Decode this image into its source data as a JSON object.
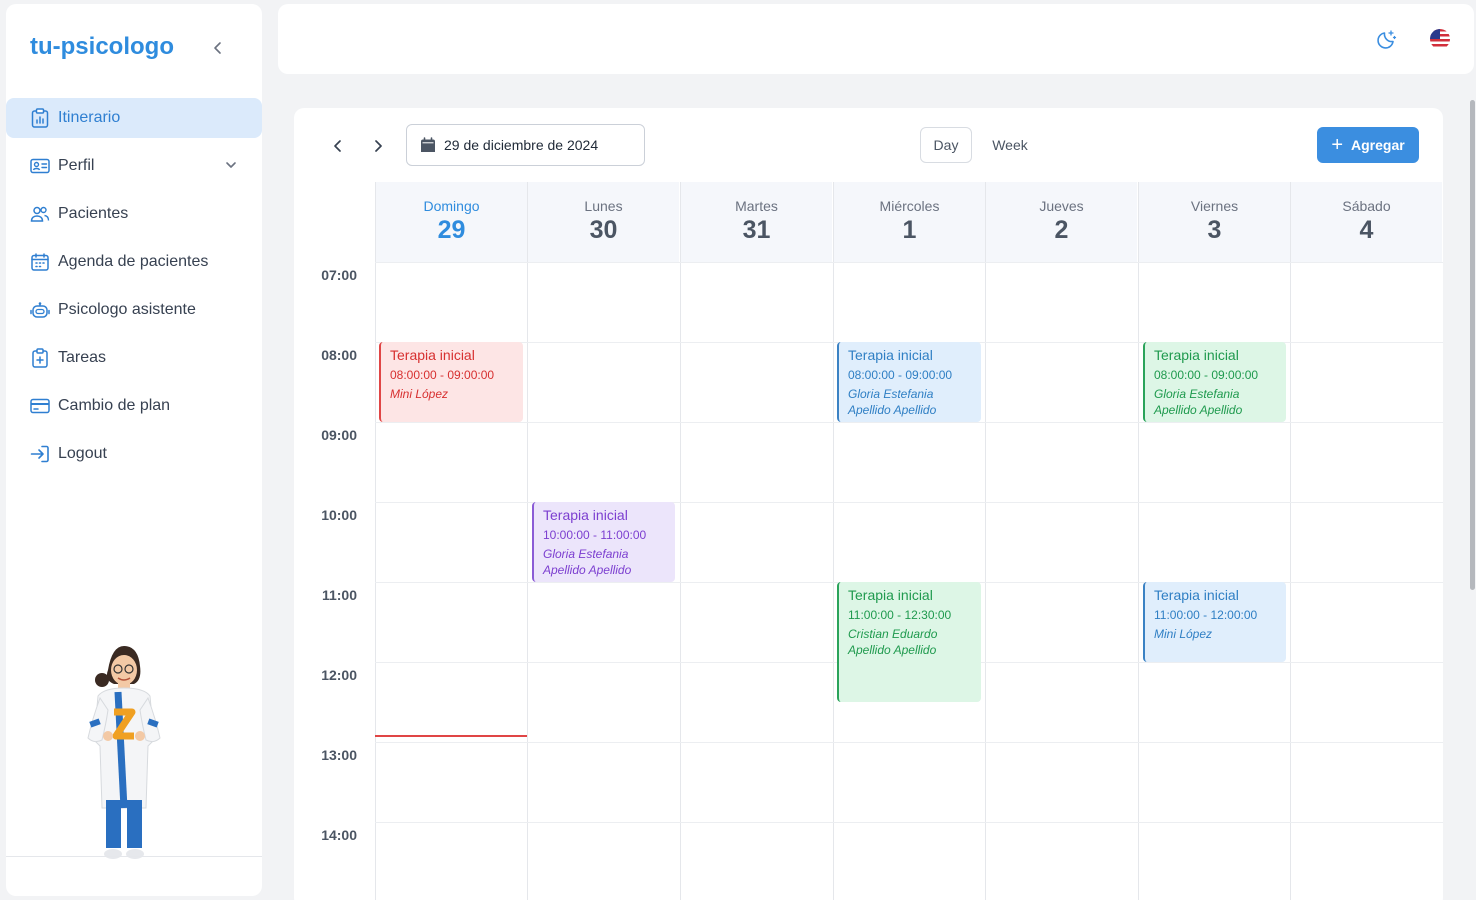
{
  "app": {
    "brand": "tu-psicologo"
  },
  "sidebar": {
    "items": [
      {
        "label": "Itinerario",
        "icon": "clipboard-chart-icon",
        "active": true
      },
      {
        "label": "Perfil",
        "icon": "id-card-icon",
        "has_chevron": true
      },
      {
        "label": "Pacientes",
        "icon": "users-icon"
      },
      {
        "label": "Agenda de pacientes",
        "icon": "calendar-grid-icon"
      },
      {
        "label": "Psicologo asistente",
        "icon": "robot-icon"
      },
      {
        "label": "Tareas",
        "icon": "clipboard-plus-icon"
      },
      {
        "label": "Cambio de plan",
        "icon": "credit-card-icon"
      },
      {
        "label": "Logout",
        "icon": "logout-icon"
      }
    ]
  },
  "topbar": {
    "theme_icon": "moon-stars-icon",
    "language_icon": "us-flag-icon"
  },
  "calendar": {
    "current_date": "29 de diciembre de 2024",
    "views": {
      "day": "Day",
      "week": "Week"
    },
    "add_label": "Agregar",
    "days": [
      {
        "name": "Domingo",
        "num": "29",
        "today": true
      },
      {
        "name": "Lunes",
        "num": "30"
      },
      {
        "name": "Martes",
        "num": "31"
      },
      {
        "name": "Miércoles",
        "num": "1"
      },
      {
        "name": "Jueves",
        "num": "2"
      },
      {
        "name": "Viernes",
        "num": "3"
      },
      {
        "name": "Sábado",
        "num": "4"
      }
    ],
    "hours": [
      "07:00",
      "08:00",
      "09:00",
      "10:00",
      "11:00",
      "12:00",
      "13:00",
      "14:00"
    ],
    "events": [
      {
        "title": "Terapia inicial",
        "time": "08:00:00 - 09:00:00",
        "patient": "Mini López",
        "color": "red"
      },
      {
        "title": "Terapia inicial",
        "time": "10:00:00 - 11:00:00",
        "patient": "Gloria Estefania Apellido Apellido",
        "color": "purple"
      },
      {
        "title": "Terapia inicial",
        "time": "08:00:00 - 09:00:00",
        "patient": "Gloria Estefania Apellido Apellido",
        "color": "blue"
      },
      {
        "title": "Terapia inicial",
        "time": "11:00:00 - 12:30:00",
        "patient": "Cristian Eduardo Apellido Apellido",
        "color": "green"
      },
      {
        "title": "Terapia inicial",
        "time": "08:00:00 - 09:00:00",
        "patient": "Gloria Estefania Apellido Apellido",
        "color": "green"
      },
      {
        "title": "Terapia inicial",
        "time": "11:00:00 - 12:00:00",
        "patient": "Mini López",
        "color": "blue"
      }
    ]
  },
  "colors": {
    "brand": "#2f8cde",
    "accent": "#3b8ee0",
    "active_bg": "#dbeafb",
    "now_line": "#e04545"
  }
}
